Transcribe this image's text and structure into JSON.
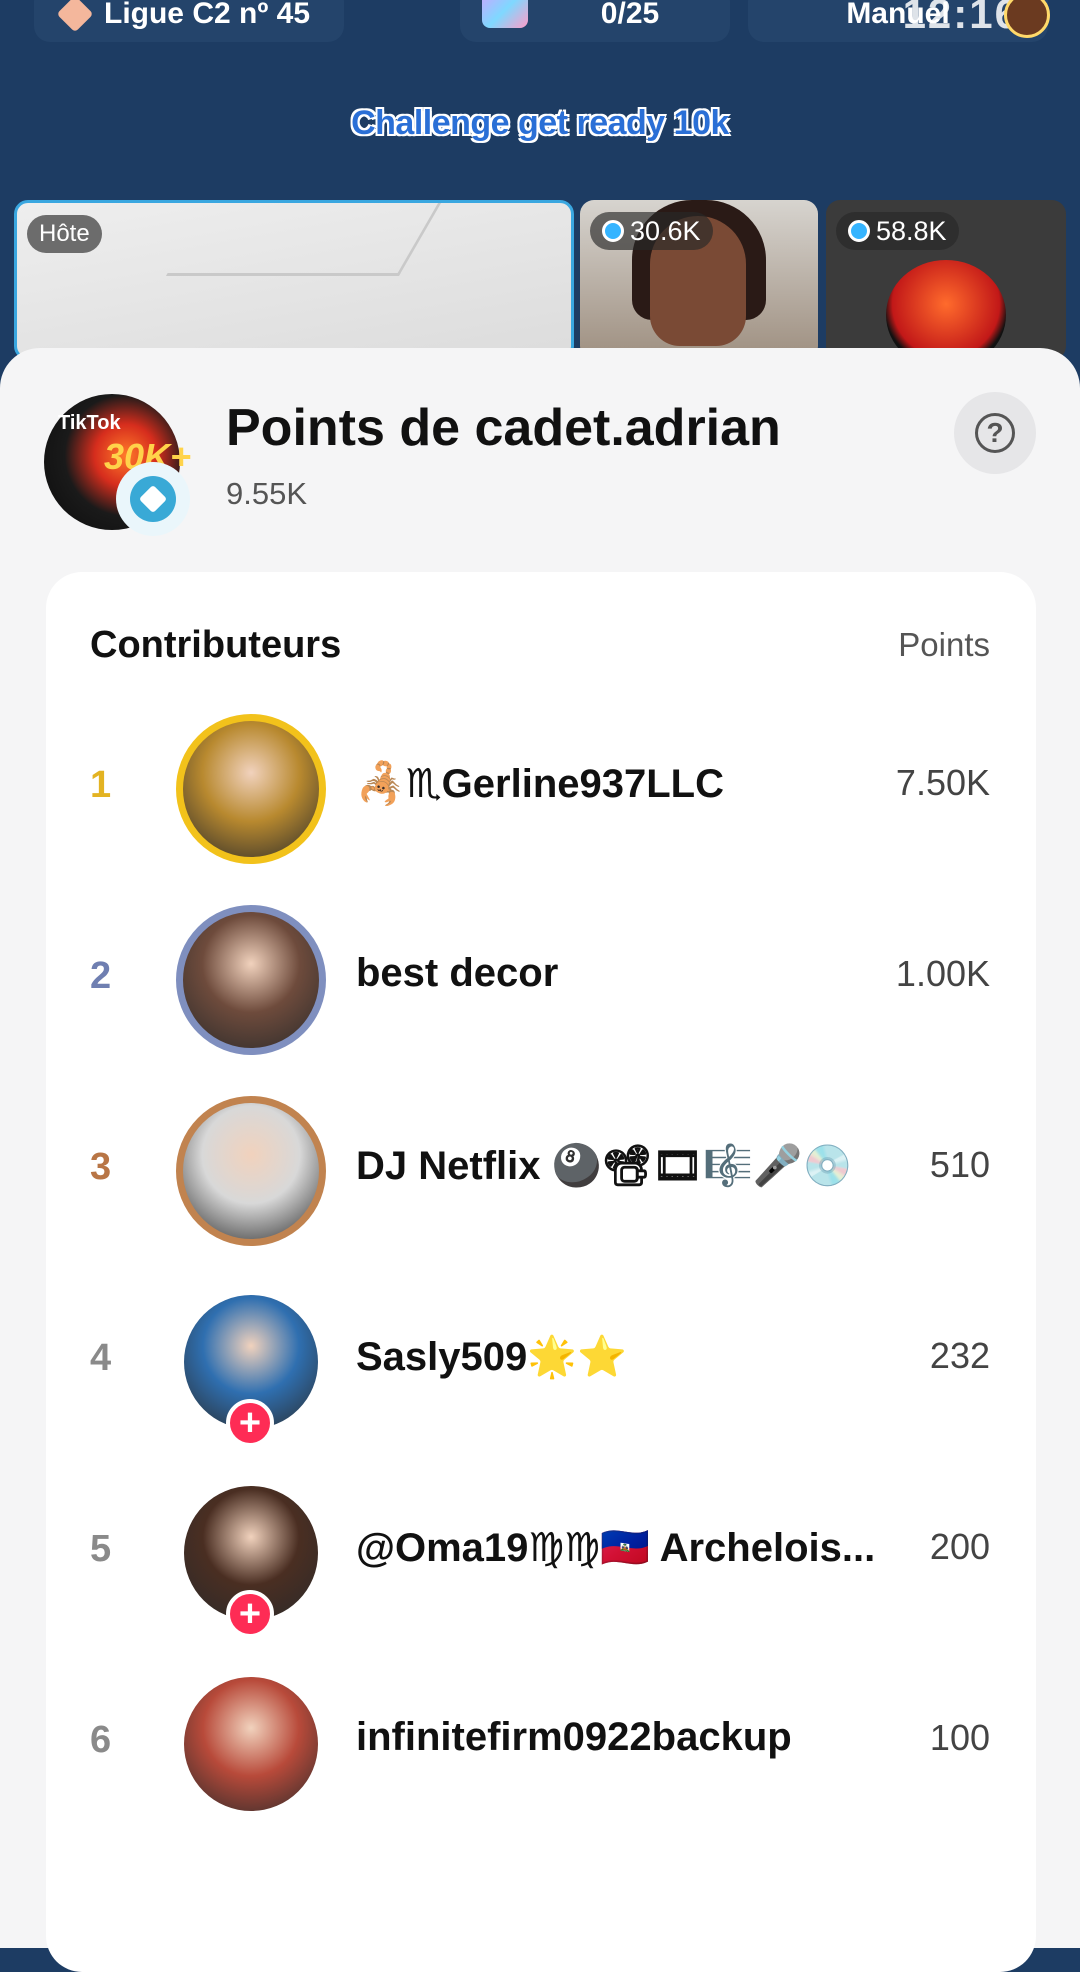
{
  "status": {
    "time": "12:16"
  },
  "top_bar": {
    "league": "Ligue C2 nº 45",
    "gift_progress": "0/25",
    "mode": "Manuel"
  },
  "stream": {
    "challenge_text": "Challenge get ready 10k",
    "host_tag": "Hôte",
    "guests": [
      {
        "score": "30.6K"
      },
      {
        "score": "58.8K"
      }
    ]
  },
  "sheet": {
    "title": "Points de cadet.adrian",
    "points": "9.55K",
    "avatar_text_small": "TikTok",
    "avatar_text_big": "30K+",
    "help_symbol": "?",
    "list_title": "Contributeurs",
    "list_column": "Points",
    "contributors": [
      {
        "rank": "1",
        "name": "🦂♏Gerline937LLC",
        "points": "7.50K",
        "rank_color": "#e3b322",
        "ring": "#f2c21b",
        "avatar": "#b8892f"
      },
      {
        "rank": "2",
        "name": "best decor",
        "points": "1.00K",
        "rank_color": "#6f7fb1",
        "ring": "#7f8fbf",
        "avatar": "#6e4b3c"
      },
      {
        "rank": "3",
        "name": "DJ Netflix 🎱📽🎞🎼🎤💿",
        "points": "510",
        "rank_color": "#b87545",
        "ring": "#c1834f",
        "avatar": "#d8d8d8"
      },
      {
        "rank": "4",
        "name": "Sasly509🌟⭐",
        "points": "232",
        "rank_color": "#8a8a8a",
        "ring": "",
        "avatar": "#2f6fb0",
        "follow": "+"
      },
      {
        "rank": "5",
        "name": "@Oma19♍♍🇭🇹 Archelois...",
        "points": "200",
        "rank_color": "#8a8a8a",
        "ring": "",
        "avatar": "#4a2e22",
        "follow": "+"
      },
      {
        "rank": "6",
        "name": "infinitefirm0922backup",
        "points": "100",
        "rank_color": "#8a8a8a",
        "ring": "",
        "avatar": "#b84a3a"
      }
    ]
  }
}
